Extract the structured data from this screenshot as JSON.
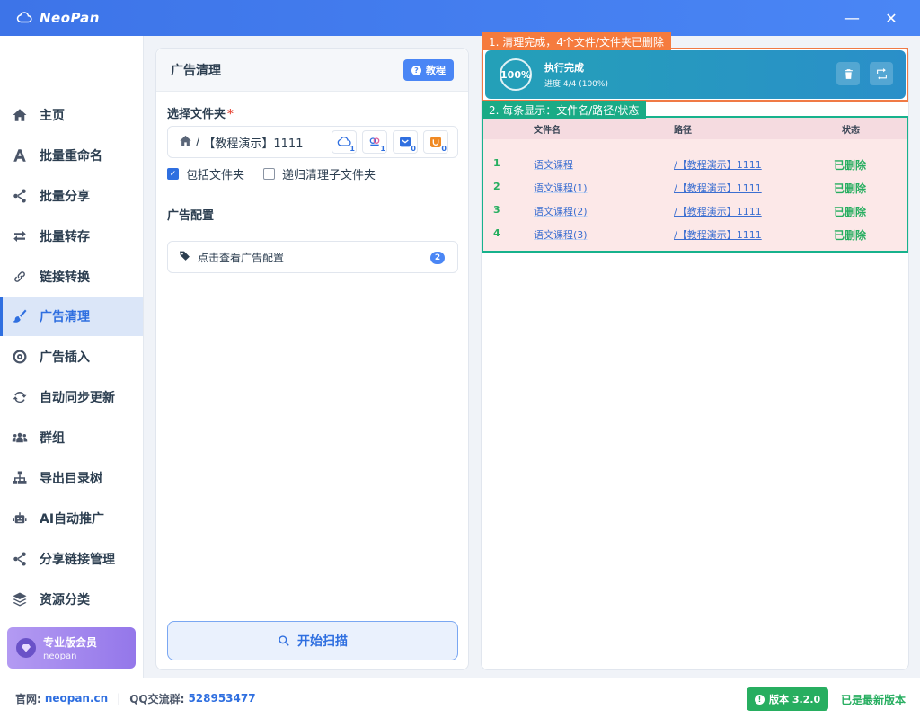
{
  "app": {
    "title": "NeoPan"
  },
  "sidebar": {
    "items": [
      {
        "label": "主页",
        "icon": "home-icon"
      },
      {
        "label": "批量重命名",
        "icon": "font-icon"
      },
      {
        "label": "批量分享",
        "icon": "share-icon"
      },
      {
        "label": "批量转存",
        "icon": "exchange-icon"
      },
      {
        "label": "链接转换",
        "icon": "link-icon"
      },
      {
        "label": "广告清理",
        "icon": "broom-icon",
        "active": true
      },
      {
        "label": "广告插入",
        "icon": "target-icon"
      },
      {
        "label": "自动同步更新",
        "icon": "sync-icon"
      },
      {
        "label": "群组",
        "icon": "users-icon"
      },
      {
        "label": "导出目录树",
        "icon": "sitemap-icon"
      },
      {
        "label": "AI自动推广",
        "icon": "robot-icon"
      },
      {
        "label": "分享链接管理",
        "icon": "share-icon"
      },
      {
        "label": "资源分类",
        "icon": "layers-icon"
      }
    ],
    "pro": {
      "title": "专业版会员",
      "user": "neopan"
    }
  },
  "middle": {
    "title": "广告清理",
    "tutorial_label": "教程",
    "folder_label": "选择文件夹",
    "required_mark": "*",
    "path_sep": "/",
    "path_text": "【教程演示】1111",
    "cloud_counts": [
      "1",
      "1",
      "0",
      "0"
    ],
    "include_folders": {
      "label": "包括文件夹",
      "checked": true
    },
    "recursive": {
      "label": "递归清理子文件夹",
      "checked": false
    },
    "ad_config_section": "广告配置",
    "ad_config_link": "点击查看广告配置",
    "ad_config_count": "2",
    "scan_button": "开始扫描"
  },
  "right": {
    "annotation1": "1. 清理完成，4个文件/文件夹已删除",
    "annotation2": "2. 每条显示：文件名/路径/状态",
    "status": {
      "percent": "100%",
      "title": "执行完成",
      "progress": "进度 4/4 (100%)"
    },
    "table": {
      "headers": {
        "name": "文件名",
        "path": "路径",
        "status": "状态"
      },
      "rows": [
        {
          "idx": "1",
          "name": "语文课程",
          "path": "/【教程演示】1111",
          "status": "已删除"
        },
        {
          "idx": "2",
          "name": "语文课程(1)",
          "path": "/【教程演示】1111",
          "status": "已删除"
        },
        {
          "idx": "3",
          "name": "语文课程(2)",
          "path": "/【教程演示】1111",
          "status": "已删除"
        },
        {
          "idx": "4",
          "name": "语文课程(3)",
          "path": "/【教程演示】1111",
          "status": "已删除"
        }
      ]
    }
  },
  "footer": {
    "site_label": "官网:",
    "site": "neopan.cn",
    "qq_label": "QQ交流群:",
    "qq": "528953477",
    "version": "版本 3.2.0",
    "latest": "已是最新版本"
  },
  "colors": {
    "primary": "#2f6fe0",
    "success": "#27ae60",
    "annotation_orange": "#f57b3e",
    "annotation_green": "#1aab86"
  }
}
